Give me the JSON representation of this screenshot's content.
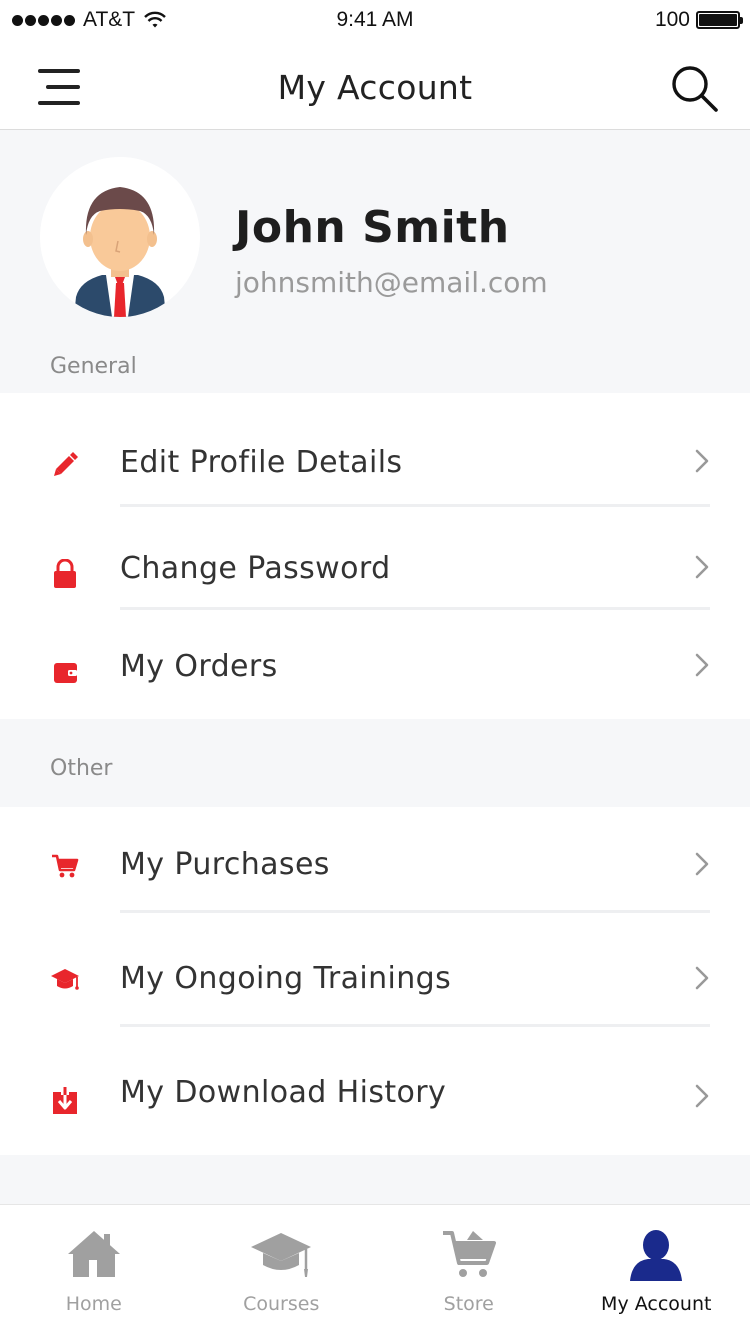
{
  "status_bar": {
    "carrier": "AT&T",
    "time": "9:41 AM",
    "battery": "100",
    "battery_level": 1.0
  },
  "header": {
    "title": "My Account",
    "menu_icon": "hamburger-menu-icon",
    "search_icon": "search-icon"
  },
  "profile": {
    "name": "John Smith",
    "email": "johnsmith@email.com"
  },
  "sections": {
    "general": {
      "label": "General",
      "items": [
        {
          "label": "Edit Profile Details",
          "icon": "pencil-icon"
        },
        {
          "label": "Change Password",
          "icon": "lock-icon"
        },
        {
          "label": "My Orders",
          "icon": "wallet-icon"
        }
      ]
    },
    "other": {
      "label": "Other",
      "items": [
        {
          "label": "My Purchases",
          "icon": "shopping-cart-icon"
        },
        {
          "label": "My Ongoing Trainings",
          "icon": "graduation-cap-icon"
        },
        {
          "label": "My Download History",
          "icon": "download-icon"
        }
      ]
    }
  },
  "tab_bar": {
    "tabs": [
      {
        "label": "Home",
        "icon": "home-icon"
      },
      {
        "label": "Courses",
        "icon": "graduation-cap-icon"
      },
      {
        "label": "Store",
        "icon": "cart-icon"
      },
      {
        "label": "My Account",
        "icon": "user-icon"
      }
    ],
    "active_index": 3
  },
  "colors": {
    "accent": "#e8262c",
    "active_tab": "#1a2a8c",
    "inactive_tab": "#a0a0a0",
    "background": "#f6f7f9"
  }
}
